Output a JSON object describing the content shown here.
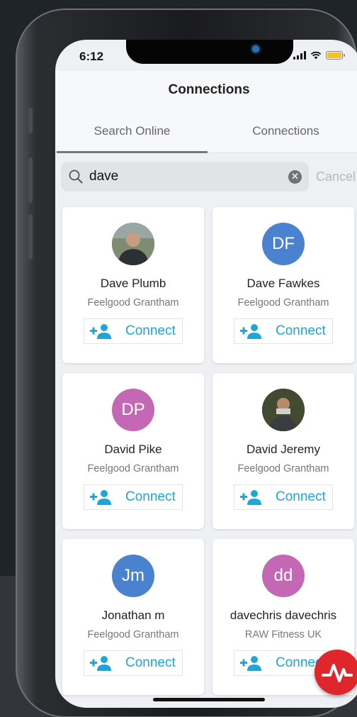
{
  "status_bar": {
    "time": "6:12"
  },
  "header": {
    "title": "Connections"
  },
  "tabs": [
    {
      "label": "Search Online",
      "active": true
    },
    {
      "label": "Connections",
      "active": false
    }
  ],
  "search": {
    "value": "dave",
    "cancel_label": "Cancel"
  },
  "results": [
    {
      "name": "Dave Plumb",
      "organization": "Feelgood Grantham",
      "initials": "",
      "avatar_type": "photo",
      "avatar_color": "#5c6b5a",
      "connect_label": "Connect"
    },
    {
      "name": "Dave Fawkes",
      "organization": "Feelgood Grantham",
      "initials": "DF",
      "avatar_type": "initials",
      "avatar_color": "#4a82cf",
      "connect_label": "Connect"
    },
    {
      "name": "David Pike",
      "organization": "Feelgood Grantham",
      "initials": "DP",
      "avatar_type": "initials",
      "avatar_color": "#c468b6",
      "connect_label": "Connect"
    },
    {
      "name": "David Jeremy",
      "organization": "Feelgood Grantham",
      "initials": "",
      "avatar_type": "photo",
      "avatar_color": "#2b2c32",
      "connect_label": "Connect"
    },
    {
      "name": "Jonathan m",
      "organization": "Feelgood Grantham",
      "initials": "Jm",
      "avatar_type": "initials",
      "avatar_color": "#4a82cf",
      "connect_label": "Connect"
    },
    {
      "name": "davechris davechris",
      "organization": "RAW Fitness UK",
      "initials": "dd",
      "avatar_type": "initials",
      "avatar_color": "#c468b6",
      "connect_label": "Connect"
    }
  ],
  "colors": {
    "accent": "#1ea6d6",
    "fab": "#e0262d"
  },
  "icons": {
    "search": "search-icon",
    "clear": "clear-search-icon",
    "add_user": "add-user-icon",
    "fab": "activity-pulse-icon"
  }
}
